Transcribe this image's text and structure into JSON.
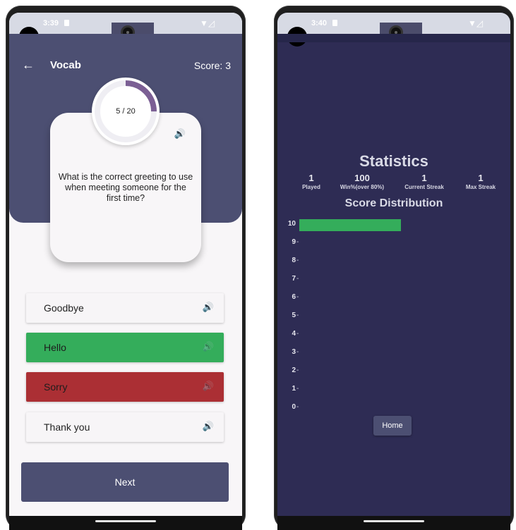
{
  "left_screen": {
    "status": {
      "time": "3:39"
    },
    "header": {
      "title": "Vocab",
      "score": "Score: 3"
    },
    "progress": {
      "text": "5 / 20",
      "current": 5,
      "total": 20
    },
    "question": "What is the correct greeting to use when meeting someone for the first time?",
    "options": [
      {
        "label": "Goodbye",
        "state": "neutral"
      },
      {
        "label": "Hello",
        "state": "correct"
      },
      {
        "label": "Sorry",
        "state": "wrong"
      },
      {
        "label": "Thank you",
        "state": "neutral"
      }
    ],
    "next_label": "Next",
    "colors": {
      "header": "#4c4f72",
      "correct": "#34ad5b",
      "wrong": "#ab2f34",
      "progress_arc": "#7b5f94"
    }
  },
  "right_screen": {
    "status": {
      "time": "3:40"
    },
    "title": "Statistics",
    "stats": [
      {
        "value": "1",
        "label": "Played"
      },
      {
        "value": "100",
        "label": "Win%(over 80%)"
      },
      {
        "value": "1",
        "label": "Current Streak"
      },
      {
        "value": "1",
        "label": "Max Streak"
      }
    ],
    "distribution_title": "Score Distribution",
    "distribution": [
      {
        "score": "10",
        "count": 1
      },
      {
        "score": "9",
        "count": 0
      },
      {
        "score": "8",
        "count": 0
      },
      {
        "score": "7",
        "count": 0
      },
      {
        "score": "6",
        "count": 0
      },
      {
        "score": "5",
        "count": 0
      },
      {
        "score": "4",
        "count": 0
      },
      {
        "score": "3",
        "count": 0
      },
      {
        "score": "2",
        "count": 0
      },
      {
        "score": "1",
        "count": 0
      },
      {
        "score": "0",
        "count": 0
      }
    ],
    "home_label": "Home",
    "colors": {
      "background": "#2e2c54",
      "bar": "#34ad5b"
    }
  }
}
